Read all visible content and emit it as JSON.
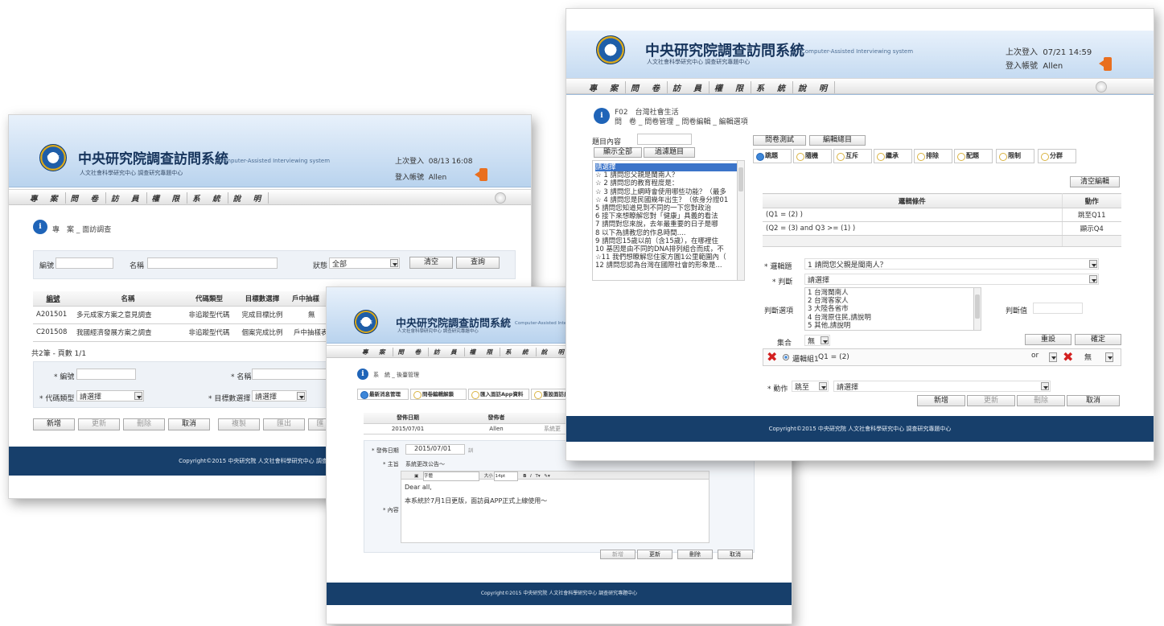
{
  "system": {
    "title": "中央研究院調查訪問系統",
    "subtitle_en": "Computer-Assisted Interviewing system",
    "subtitle_zh": "人文社會科學研究中心 調查研究專題中心",
    "login_user_label": "登入帳號",
    "last_login_label": "上次登入",
    "logo_text": "中研院"
  },
  "menu": [
    "專　案",
    "問　卷",
    "訪　員",
    "權　限",
    "系　統",
    "說　明"
  ],
  "footer": "Copyright©2015 中央研究院 人文社會科學研究中心 調查研究專題中心",
  "win1": {
    "last_login": "08/13 16:08",
    "user": "Allen",
    "breadcrumb": "專　案 _ 面訪調查",
    "search": {
      "id_label": "編號",
      "name_label": "名稱",
      "status_label": "狀態",
      "status_value": "全部",
      "clear": "清空",
      "query": "查詢"
    },
    "table": {
      "headers": [
        "編號",
        "名稱",
        "代碼類型",
        "目標數選擇",
        "戶中抽樣"
      ],
      "rows": [
        [
          "A201501",
          "多元成家方案之意見調查",
          "非追蹤型代碼",
          "完成目標比例",
          "無"
        ],
        [
          "C201508",
          "我國經濟發展方案之調查",
          "非追蹤型代碼",
          "個案完成比例",
          "戶中抽樣表"
        ]
      ],
      "summary": "共2筆 - 頁數 1/1"
    },
    "form": {
      "id_label": "* 編號",
      "name_label": "* 名稱",
      "code_type_label": "* 代碼類型",
      "code_type_value": "請選擇",
      "target_label": "* 目標數選擇",
      "target_value": "請選擇"
    },
    "buttons": [
      "新增",
      "更新",
      "刪除",
      "取消",
      "複製",
      "匯出",
      "匯"
    ]
  },
  "win2": {
    "breadcrumb": "系　統 _ 後臺管理",
    "tabs": [
      "最新消息管理",
      "問卷編輯解鎖",
      "匯入面訪App資料",
      "重設面訪員"
    ],
    "table": {
      "headers": [
        "發佈日期",
        "發佈者",
        ""
      ],
      "row": [
        "2015/07/01",
        "Allen",
        "系統更"
      ]
    },
    "publish_label": "* 發佈日期",
    "publish_value": "2015/07/01",
    "publish_hint": "訓",
    "subject_label": "* 主旨",
    "subject_value": "系統更改公告～",
    "content_label": "* 內容",
    "editor": {
      "font": "字體",
      "size_label": "大小",
      "size": "14pt"
    },
    "content_lines": [
      "Dear all,",
      "本系統於7月1日更版，面訪員APP正式上線使用～"
    ],
    "buttons": [
      "新增",
      "更新",
      "刪除",
      "取消"
    ]
  },
  "win3": {
    "last_login": "07/21 14:59",
    "user": "Allen",
    "crumb_code": "F02　台灣社會生活",
    "breadcrumb": "問　卷 _ 問卷管理 _ 問卷編輯 _ 編輯選項",
    "question_label": "題目內容",
    "show_all": "顯示全部",
    "filter": "過濾題目",
    "top_tabs": [
      "問卷測試",
      "編輯總目"
    ],
    "logic_tabs": [
      "跳題",
      "隨機",
      "互斥",
      "繼承",
      "排除",
      "配題",
      "限制",
      "分群"
    ],
    "questions": [
      "請選擇",
      "☆ 1 請問您父親是閩南人？",
      "☆ 2 請問您的教育程度是：",
      "☆ 3 請問您上網時會使用哪些功能？（最多",
      "☆ 4 請問您是民國幾年出生？（依身分證01",
      "  5 請問您知道見到不同的一下您對政治",
      "  6 接下來想瞭解您對「健康」具義的看法",
      "  7 請問對您來說，去年最重要的日子是哪",
      "  8 以下為請教您的作息時間....",
      "  9 請問您15歲以前（含15歲），在哪裡住",
      "  10 基因是由不同的DNA排列組合而成，不",
      "☆11 我們想瞭解您住家方圓1公里範圍內（",
      "  12 請問您認為台灣在國際社會的形象是..."
    ],
    "clear_edit": "清空編輯",
    "rules_table": {
      "headers": [
        "邏輯條件",
        "動作"
      ],
      "rows": [
        [
          "(Q1 = (2) )",
          "跳至Q11"
        ],
        [
          "(Q2 = (3) and Q3 >= (1) )",
          "顯示Q4"
        ]
      ]
    },
    "logic_q_label": "* 邏輯題",
    "logic_q_value": "1 請問您父親是閩南人？",
    "judge_label": "* 判斷",
    "judge_value": "請選擇",
    "judge_items_label": "判斷選項",
    "judge_items": [
      "1 台灣閩南人",
      "2 台灣客家人",
      "3 大陸各省市",
      "4 台灣原住民,請說明",
      "5 其他,請說明"
    ],
    "judge_value_label": "判斷值",
    "set_label": "集合",
    "set_value": "無",
    "reset": "重設",
    "confirm": "確定",
    "group_expr": "邏輯組1",
    "group_cond": "Q1 = (2)",
    "or_value": "or",
    "none_value": "無",
    "action_label": "* 動作",
    "action_value": "跳至",
    "action_target": "請選擇",
    "buttons": [
      "新增",
      "更新",
      "刪除",
      "取消"
    ]
  }
}
